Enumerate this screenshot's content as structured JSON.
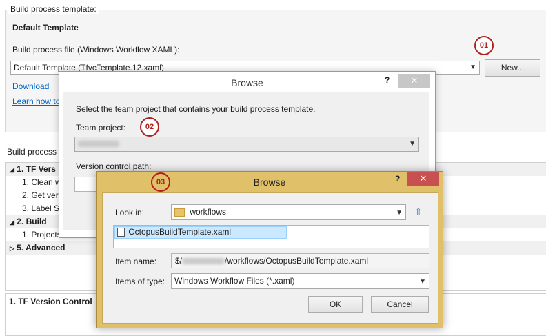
{
  "background": {
    "group_label": "Build process template:",
    "template_name": "Default Template",
    "file_label": "Build process file (Windows Workflow XAML):",
    "file_value": "Default Template (TfvcTemplate.12.xaml)",
    "new_button": "New...",
    "download_link": "Download",
    "learn_link": "Learn how to",
    "params_label": "Build process p",
    "tree": [
      {
        "label": "1. TF Vers",
        "group": true,
        "expanded": true
      },
      {
        "label": "1. Clean w",
        "group": false
      },
      {
        "label": "2. Get vers",
        "group": false
      },
      {
        "label": "3. Label Sc",
        "group": false
      },
      {
        "label": "2. Build",
        "group": true,
        "expanded": true
      },
      {
        "label": "1. Projects",
        "group": false
      },
      {
        "label": "5. Advanced",
        "group": true,
        "expanded": false
      }
    ],
    "detail_title": "1. TF Version Control"
  },
  "badges": {
    "b1": "01",
    "b2": "02",
    "b3": "03"
  },
  "dialog_project": {
    "title": "Browse",
    "help": "?",
    "close": "✕",
    "instruction": "Select the team project that contains your build process template.",
    "team_project_label": "Team project:",
    "version_path_label": "Version control path:"
  },
  "dialog_file": {
    "title": "Browse",
    "help": "?",
    "close": "✕",
    "look_in_label": "Look in:",
    "look_in_value": "workflows",
    "file_item": "OctopusBuildTemplate.xaml",
    "item_name_label": "Item name:",
    "item_name_prefix": "$/",
    "item_name_suffix": "/workflows/OctopusBuildTemplate.xaml",
    "items_type_label": "Items of type:",
    "items_type_value": "Windows Workflow Files (*.xaml)",
    "ok": "OK",
    "cancel": "Cancel"
  },
  "colors": {
    "badge": "#b0201f",
    "close": "#c75050",
    "dialog_frame": "#e0c16a",
    "link": "#0066cc"
  }
}
